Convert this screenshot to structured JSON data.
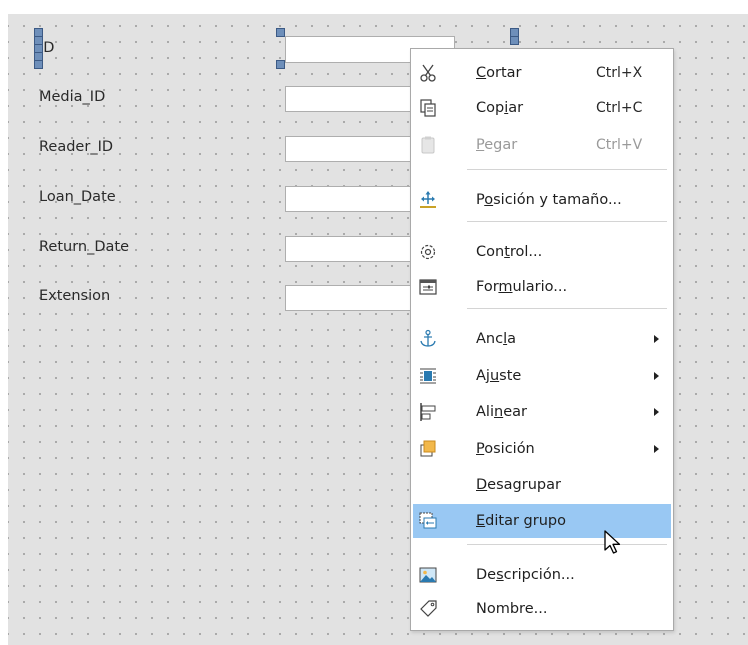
{
  "form": {
    "fields": [
      {
        "label": "ID"
      },
      {
        "label": "Media_ID"
      },
      {
        "label": "Reader_ID"
      },
      {
        "label": "Loan_Date"
      },
      {
        "label": "Return_Date"
      },
      {
        "label": "Extension"
      }
    ]
  },
  "menu": {
    "items": [
      {
        "pre": "",
        "accel": "C",
        "post": "ortar",
        "shortcut": "Ctrl+X",
        "icon": "scissors-icon"
      },
      {
        "pre": "Cop",
        "accel": "i",
        "post": "ar",
        "shortcut": "Ctrl+C",
        "icon": "copy-icon"
      },
      {
        "pre": "",
        "accel": "P",
        "post": "egar",
        "shortcut": "Ctrl+V",
        "icon": "paste-icon",
        "disabled": true
      },
      {
        "pre": "P",
        "accel": "o",
        "post": "sición y tamaño...",
        "icon": "position-size-icon"
      },
      {
        "pre": "Con",
        "accel": "t",
        "post": "rol...",
        "icon": "gear-icon"
      },
      {
        "pre": "For",
        "accel": "m",
        "post": "ulario...",
        "icon": "form-icon"
      },
      {
        "pre": "Anc",
        "accel": "l",
        "post": "a",
        "icon": "anchor-icon",
        "submenu": true
      },
      {
        "pre": "Aj",
        "accel": "u",
        "post": "ste",
        "icon": "wrap-icon",
        "submenu": true
      },
      {
        "pre": "Ali",
        "accel": "n",
        "post": "ear",
        "icon": "align-icon",
        "submenu": true
      },
      {
        "pre": "",
        "accel": "P",
        "post": "osición",
        "icon": "arrange-icon",
        "submenu": true
      },
      {
        "pre": "",
        "accel": "D",
        "post": "esagrupar",
        "icon": ""
      },
      {
        "pre": "",
        "accel": "E",
        "post": "ditar grupo",
        "icon": "edit-group-icon",
        "highlighted": true
      },
      {
        "pre": "De",
        "accel": "s",
        "post": "cripción...",
        "icon": "image-icon"
      },
      {
        "pre": "Nombre...",
        "accel": "",
        "post": "",
        "icon": "tag-icon"
      }
    ]
  },
  "colors": {
    "canvas": "#e2e2e2",
    "highlight": "#99c8f3",
    "handle": "#6e8fba"
  }
}
